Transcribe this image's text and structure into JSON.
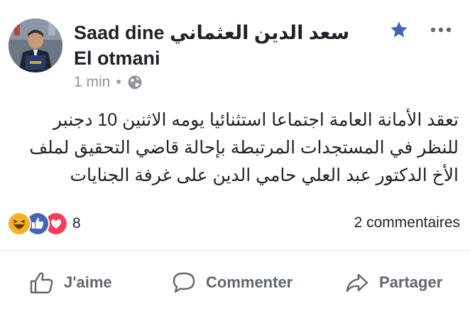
{
  "post": {
    "author": "سعد الدين العثماني Saad dine El otmani",
    "time": "1 min",
    "separator": "•",
    "privacy_icon": "globe-icon",
    "body_lines": [
      "تعقد الأمانة العامة اجتماعا استثنائيا يومه الاثنين 10 دجنبر",
      "للنظر في المستجدات المرتبطة بإحالة قاضي التحقيق لملف",
      "الأخ الدكتور عبد العلي حامي الدين على غرفة الجنايات"
    ],
    "reaction_icons": [
      "haha-icon",
      "like-icon",
      "love-icon"
    ],
    "reaction_count": "8",
    "comments_count": "2 commentaires"
  },
  "actions": {
    "like_label": "J'aime",
    "comment_label": "Commenter",
    "share_label": "Partager"
  },
  "colors": {
    "accent": "#4267b2",
    "text": "#1d2129",
    "muted": "#90949c",
    "action": "#606770",
    "love": "#f33e58",
    "haha": "#f7b125"
  }
}
